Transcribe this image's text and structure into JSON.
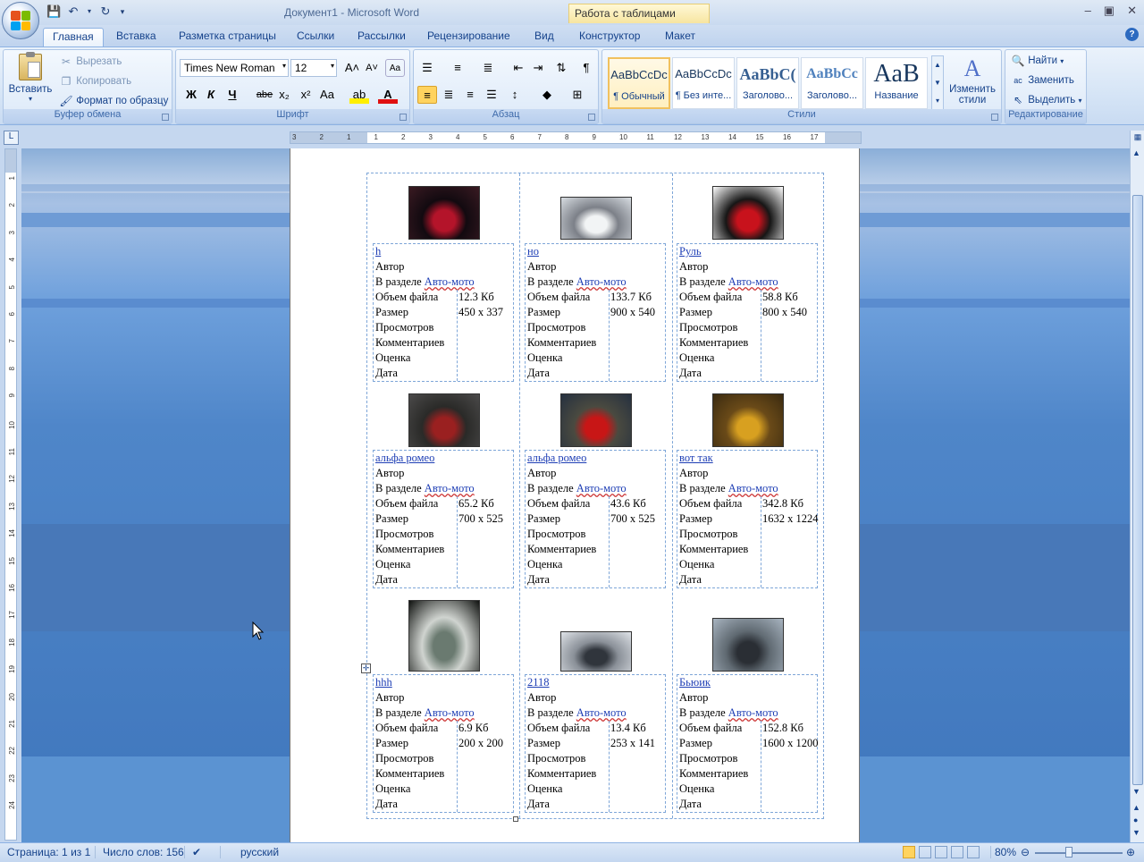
{
  "window": {
    "title": "Документ1 - Microsoft Word",
    "context_tab_header": "Работа с таблицами"
  },
  "tabs": [
    "Главная",
    "Вставка",
    "Разметка страницы",
    "Ссылки",
    "Рассылки",
    "Рецензирование",
    "Вид",
    "Конструктор",
    "Макет"
  ],
  "clipboard": {
    "paste": "Вставить",
    "cut": "Вырезать",
    "copy": "Копировать",
    "format_painter": "Формат по образцу",
    "label": "Буфер обмена"
  },
  "font": {
    "name": "Times New Roman",
    "size": "12",
    "label": "Шрифт",
    "bold": "Ж",
    "italic": "К",
    "underline": "Ч",
    "strike": "abe",
    "sub": "x₂",
    "sup": "x²",
    "case": "Aa"
  },
  "paragraph": {
    "label": "Абзац"
  },
  "styles": {
    "label": "Стили",
    "items": [
      {
        "sample": "AaBbCcDc",
        "name": "¶ Обычный"
      },
      {
        "sample": "AaBbCcDc",
        "name": "¶ Без инте..."
      },
      {
        "sample": "AaBbC(",
        "name": "Заголово..."
      },
      {
        "sample": "AaBbCc",
        "name": "Заголово..."
      },
      {
        "sample": "AaB",
        "name": "Название"
      }
    ],
    "change": "Изменить стили"
  },
  "editing": {
    "find": "Найти",
    "replace": "Заменить",
    "select": "Выделить",
    "label": "Редактирование"
  },
  "ruler": {
    "h": [
      "3",
      "2",
      "1",
      "1",
      "2",
      "3",
      "4",
      "5",
      "6",
      "7",
      "8",
      "9",
      "10",
      "11",
      "12",
      "13",
      "14",
      "15",
      "16",
      "17"
    ],
    "v": [
      "1",
      "2",
      "3",
      "4",
      "5",
      "6",
      "7",
      "8",
      "9",
      "10",
      "11",
      "12",
      "13",
      "14",
      "15",
      "16",
      "17",
      "18",
      "19",
      "20",
      "21",
      "22",
      "23",
      "24"
    ]
  },
  "labels": {
    "author": "Автор",
    "section": "В разделе",
    "section_link": "Авто-мото",
    "size": "Объем файла",
    "dims": "Размер",
    "views": "Просмотров",
    "comments": "Комментариев",
    "rating": "Оценка",
    "date": "Дата"
  },
  "cells": [
    {
      "title": "h",
      "size": "12.3 Кб",
      "dims": "450 х 337",
      "thumb_colors": [
        "#3a1a22",
        "#b4142a",
        "#120a10"
      ]
    },
    {
      "title": "но",
      "size": "133.7 Кб",
      "dims": "900 х 540",
      "thumb_colors": [
        "#d8dde2",
        "#f2f4f5",
        "#7c8088"
      ]
    },
    {
      "title": "Руль",
      "size": "58.8 Кб",
      "dims": "800 х 540",
      "thumb_colors": [
        "#ffffff",
        "#c8121c",
        "#161616"
      ]
    },
    {
      "title": "альфа ромео",
      "size": "65.2 Кб",
      "dims": "700 х 525",
      "thumb_colors": [
        "#4b4a4a",
        "#9a2020",
        "#2a2a28"
      ]
    },
    {
      "title": "альфа ромео",
      "size": "43.6 Кб",
      "dims": "700 х 525",
      "thumb_colors": [
        "#253040",
        "#c81616",
        "#4a4a40"
      ]
    },
    {
      "title": "вот так",
      "size": "342.8 Кб",
      "dims": "1632 х 1224",
      "thumb_colors": [
        "#3a2a10",
        "#d8a020",
        "#6a4a18"
      ]
    },
    {
      "title": "hhh",
      "size": "6.9 Кб",
      "dims": "200 х 200",
      "thumb_colors": [
        "#101210",
        "#6a7a70",
        "#d0d4d0"
      ]
    },
    {
      "title": "2118",
      "size": "13.4 Кб",
      "dims": "253 х 141",
      "thumb_colors": [
        "#dfe3e8",
        "#30353c",
        "#8a9098"
      ]
    },
    {
      "title": "Бьюик",
      "size": "152.8 Кб",
      "dims": "1600 х 1200",
      "thumb_colors": [
        "#a8b4c0",
        "#2a2e34",
        "#606a72"
      ]
    }
  ],
  "status": {
    "page": "Страница: 1 из 1",
    "words": "Число слов: 156",
    "lang": "русский",
    "zoom": "80%"
  }
}
